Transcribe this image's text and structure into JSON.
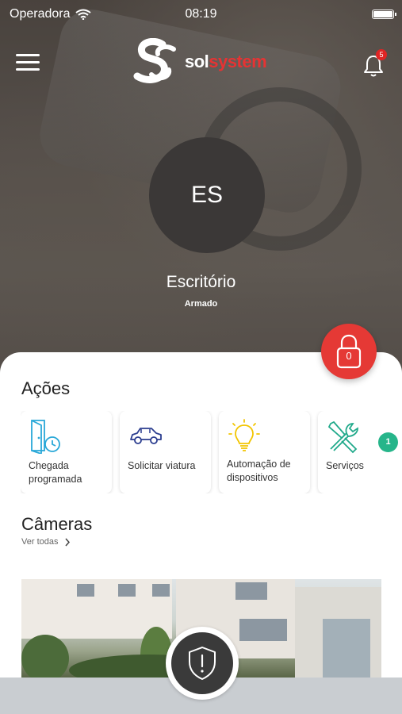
{
  "status_bar": {
    "carrier": "Operadora",
    "time": "08:19",
    "wifi_icon": "wifi-icon",
    "battery_icon": "battery-icon"
  },
  "header": {
    "menu_icon": "hamburger-menu-icon",
    "logo": {
      "part1": "sol",
      "part2": "system",
      "icon": "solsystem-logo-icon"
    },
    "notifications": {
      "icon": "bell-icon",
      "count": "5"
    }
  },
  "site": {
    "initials": "ES",
    "name": "Escritório",
    "status": "Armado"
  },
  "lock_button": {
    "icon": "lock-icon",
    "count": "0",
    "color": "#e53935"
  },
  "actions": {
    "title": "Ações",
    "items": [
      {
        "label": "Chegada programada",
        "icon": "door-clock-icon"
      },
      {
        "label": "Solicitar viatura",
        "icon": "car-icon"
      },
      {
        "label": "Automação de dispositivos",
        "icon": "lightbulb-icon"
      },
      {
        "label": "Serviços",
        "icon": "tools-icon",
        "badge": "1"
      }
    ]
  },
  "cameras": {
    "title": "Câmeras",
    "see_all": "Ver todas"
  },
  "panic_button": {
    "icon": "shield-alert-icon"
  },
  "colors": {
    "accent_red": "#e53935",
    "badge_green": "#26b58a",
    "icon_blue": "#29a8d8",
    "icon_navy": "#2b3d8f",
    "icon_yellow": "#f2c500",
    "icon_teal": "#1fa98a"
  }
}
